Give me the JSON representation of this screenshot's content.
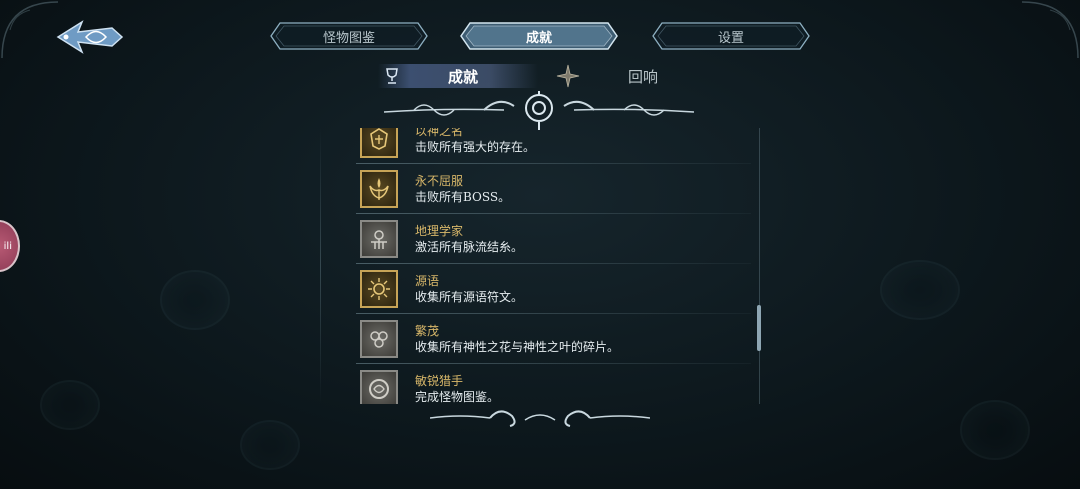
{
  "colors": {
    "accent_gold": "#d9b86a",
    "text_light": "#e6edf0",
    "active_subtab": "#5f78af",
    "background": "#0d181d"
  },
  "nav": {
    "back_icon": "ornate-arrow-left-icon"
  },
  "tabs": [
    {
      "label": "怪物图鉴",
      "active": false
    },
    {
      "label": "成就",
      "active": true
    },
    {
      "label": "设置",
      "active": false
    }
  ],
  "subtabs": [
    {
      "label": "成就",
      "icon": "trophy-icon",
      "active": true
    },
    {
      "label": "回响",
      "icon": "star-sparkle-icon",
      "active": false
    }
  ],
  "achievements": [
    {
      "title": "以神之名",
      "desc": "击败所有强大的存在。",
      "icon": "crest-icon",
      "unlocked": true
    },
    {
      "title": "永不屈服",
      "desc": "击败所有BOSS。",
      "icon": "crown-flame-icon",
      "unlocked": true
    },
    {
      "title": "地理学家",
      "desc": "激活所有脉流结糸。",
      "icon": "map-node-icon",
      "unlocked": false
    },
    {
      "title": "源语",
      "desc": "收集所有源语符文。",
      "icon": "rune-sun-icon",
      "unlocked": true
    },
    {
      "title": "繁茂",
      "desc": "收集所有神性之花与神性之叶的碎片。",
      "icon": "flower-icon",
      "unlocked": false
    },
    {
      "title": "敏锐猎手",
      "desc": "完成怪物图鉴。",
      "icon": "beast-ring-icon",
      "unlocked": false
    }
  ],
  "side_badge": {
    "text": "ili"
  }
}
